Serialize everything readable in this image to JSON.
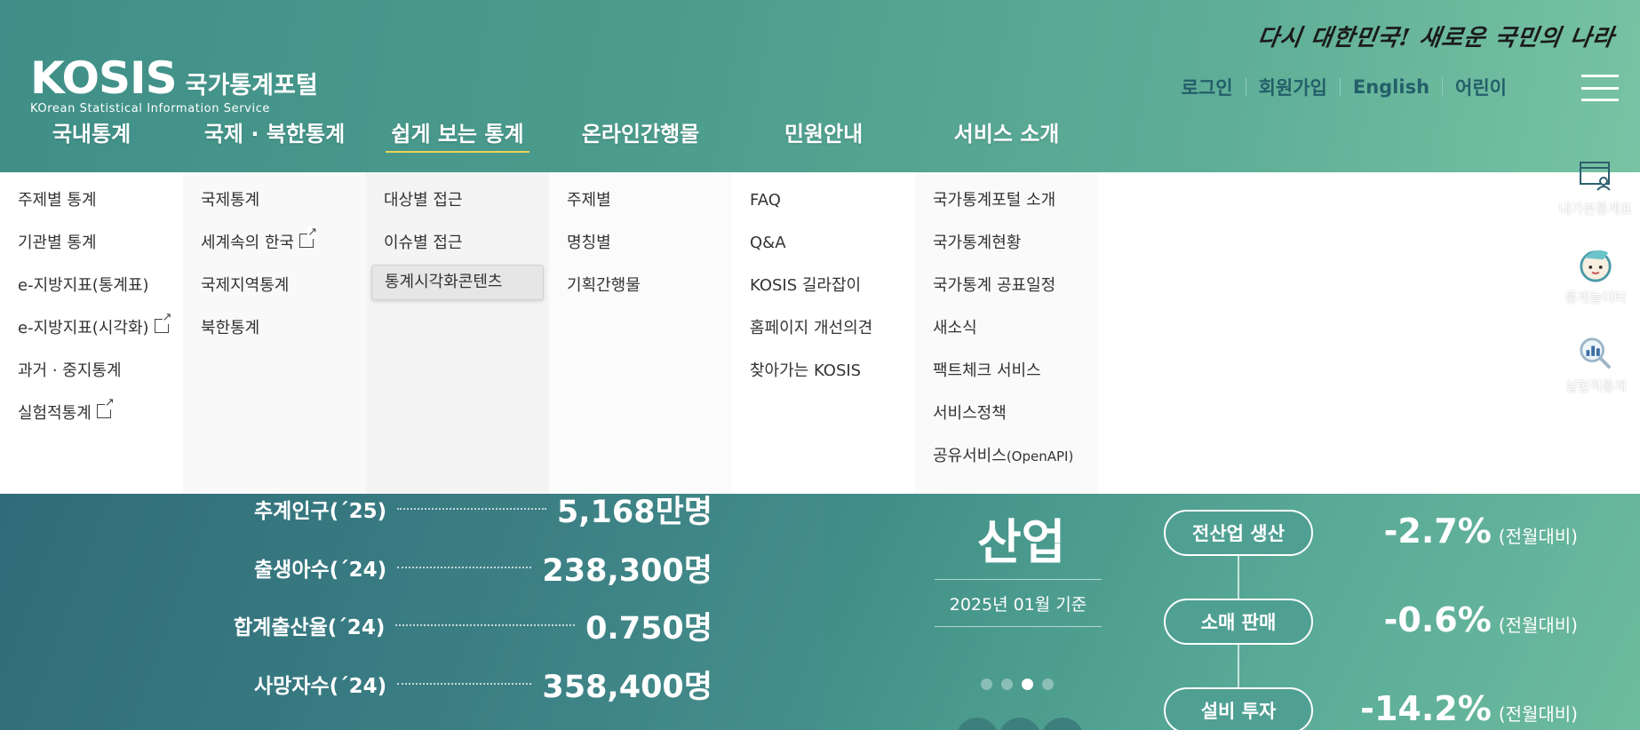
{
  "slogan": "다시 대한민국! 새로운 국민의 나라",
  "logo": {
    "main": "KOSIS",
    "kr": "국가통계포털",
    "sub": "KOrean Statistical Information Service"
  },
  "util_links": [
    "로그인",
    "회원가입",
    "English",
    "어린이"
  ],
  "gnb": [
    {
      "label": "국내통계",
      "active": false
    },
    {
      "label": "국제 · 북한통계",
      "active": false
    },
    {
      "label": "쉽게 보는 통계",
      "active": true
    },
    {
      "label": "온라인간행물",
      "active": false
    },
    {
      "label": "민원안내",
      "active": false
    },
    {
      "label": "서비스 소개",
      "active": false
    }
  ],
  "mega": {
    "col1": [
      "주제별 통계",
      "기관별 통계",
      "e-지방지표(통계표)",
      "e-지방지표(시각화)",
      "과거 · 중지통계",
      "실험적통계"
    ],
    "col2": [
      "국제통계",
      "세계속의 한국",
      "국제지역통계",
      "북한통계"
    ],
    "col3": [
      "대상별 접근",
      "이슈별 접근",
      "통계시각화콘텐츠"
    ],
    "col4": [
      "주제별",
      "명칭별",
      "기획간행물"
    ],
    "col5": [
      "FAQ",
      "Q&A",
      "KOSIS 길라잡이",
      "홈페이지 개선의견",
      "찾아가는 KOSIS"
    ],
    "col6": [
      "국가통계포털 소개",
      "국가통계현황",
      "국가통계 공표일정",
      "새소식",
      "팩트체크 서비스",
      "서비스정책",
      "공유서비스",
      "(OpenAPI)"
    ]
  },
  "quick_menu": [
    "내가본통계표",
    "통계놀이터",
    "실험적통계"
  ],
  "population_stats": [
    {
      "label": "추계인구(´25)",
      "value": "5,168만명"
    },
    {
      "label": "출생아수(´24)",
      "value": "238,300명"
    },
    {
      "label": "합계출산율(´24)",
      "value": "0.750명"
    },
    {
      "label": "사망자수(´24)",
      "value": "358,400명"
    }
  ],
  "industry": {
    "title": "산업",
    "date": "2025년 01월 기준",
    "items": [
      {
        "label": "전산업 생산",
        "value": "-2.7%",
        "note": "(전월대비)"
      },
      {
        "label": "소매 판매",
        "value": "-0.6%",
        "note": "(전월대비)"
      },
      {
        "label": "설비 투자",
        "value": "-14.2%",
        "note": "(전월대비)"
      }
    ],
    "pager_count": 4,
    "pager_active": 3
  },
  "colors": {
    "accent_underline": "#e8d45a",
    "util_text": "#235f6a"
  }
}
